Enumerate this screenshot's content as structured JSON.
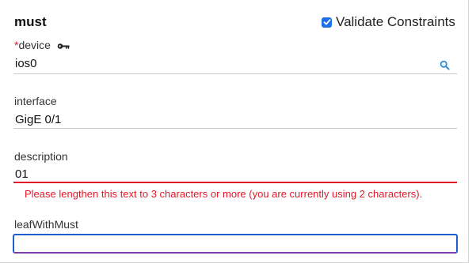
{
  "header": {
    "title": "must",
    "validate_label": "Validate Constraints",
    "validate_checked": true
  },
  "fields": {
    "device": {
      "required_mark": "*",
      "label": "device",
      "value": "ios0",
      "key_icon": "key-icon",
      "search_icon": "search-icon"
    },
    "interface": {
      "label": "interface",
      "value": "GigE 0/1"
    },
    "description": {
      "label": "description",
      "value": "01",
      "error": "Please lengthen this text to 3 characters or more (you are currently using 2 characters)."
    },
    "leafWithMust": {
      "label": "leafWithMust",
      "value": ""
    }
  },
  "colors": {
    "accent": "#1f6fe5",
    "error": "#e0192a",
    "search_icon": "#2b8fd8"
  }
}
